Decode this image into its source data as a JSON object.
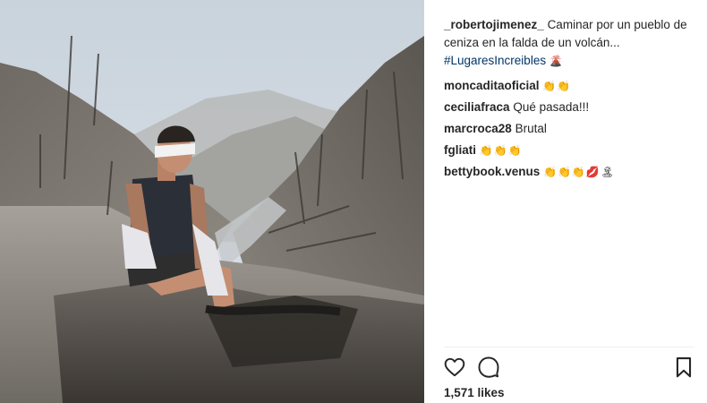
{
  "post": {
    "author": "_robertojimenez_",
    "caption": "Caminar por un pueblo de ceniza en la falda de un volcán...",
    "hashtag": "#LugaresIncreibles",
    "hashtag_emoji": "🌋"
  },
  "comments": [
    {
      "user": "moncaditaoficial",
      "text": "",
      "emoji": "👏👏"
    },
    {
      "user": "ceciliafraca",
      "text": "Qué pasada!!!",
      "emoji": ""
    },
    {
      "user": "marcroca28",
      "text": "Brutal",
      "emoji": ""
    },
    {
      "user": "fgliati",
      "text": "",
      "emoji": "👏👏👏"
    },
    {
      "user": "bettybook.venus",
      "text": "",
      "emoji": "👏👏👏💋🏝"
    }
  ],
  "actions": {
    "like_icon": "heart-outline",
    "comment_icon": "speech-bubble",
    "save_icon": "bookmark-outline"
  },
  "likes": "1,571 likes",
  "colors": {
    "text": "#262626",
    "hashtag": "#003569",
    "divider": "#efefef"
  }
}
